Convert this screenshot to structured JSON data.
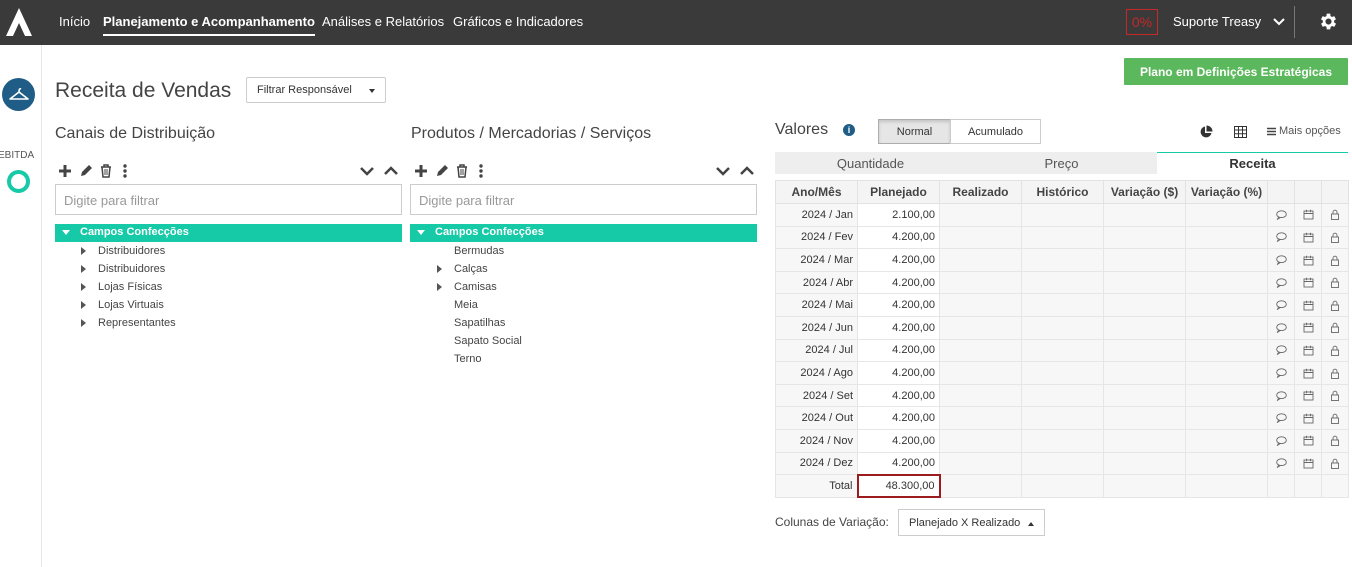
{
  "topbar": {
    "nav": [
      "Início",
      "Planejamento e Acompanhamento",
      "Análises e Relatórios",
      "Gráficos e Indicadores"
    ],
    "percent_badge": "0%",
    "user_name": "Suporte Treasy"
  },
  "sidebar": {
    "label": "EBITDA"
  },
  "page": {
    "title": "Receita de Vendas",
    "filter_responsavel": "Filtrar Responsável",
    "plan_button": "Plano em Definições Estratégicas"
  },
  "canais": {
    "title": "Canais de Distribuição",
    "filter_placeholder": "Digite para filtrar",
    "root": "Campos Confecções",
    "items": [
      {
        "label": "Distribuidores",
        "expandable": true
      },
      {
        "label": "Distribuidores",
        "expandable": true
      },
      {
        "label": "Lojas Físicas",
        "expandable": true
      },
      {
        "label": "Lojas Virtuais",
        "expandable": true
      },
      {
        "label": "Representantes",
        "expandable": true
      }
    ]
  },
  "produtos": {
    "title": "Produtos / Mercadorias / Serviços",
    "filter_placeholder": "Digite para filtrar",
    "root": "Campos Confecções",
    "items": [
      {
        "label": "Bermudas",
        "expandable": false
      },
      {
        "label": "Calças",
        "expandable": true
      },
      {
        "label": "Camisas",
        "expandable": true
      },
      {
        "label": "Meia",
        "expandable": false
      },
      {
        "label": "Sapatilhas",
        "expandable": false
      },
      {
        "label": "Sapato Social",
        "expandable": false
      },
      {
        "label": "Terno",
        "expandable": false
      }
    ]
  },
  "valores": {
    "title": "Valores",
    "toggle_normal": "Normal",
    "toggle_acumulado": "Acumulado",
    "mais_opcoes": "Mais opções",
    "tabs": [
      "Quantidade",
      "Preço",
      "Receita"
    ],
    "active_tab": "Receita",
    "columns": [
      "Ano/Mês",
      "Planejado",
      "Realizado",
      "Histórico",
      "Variação ($)",
      "Variação (%)"
    ],
    "rows": [
      {
        "mes": "2024 / Jan",
        "planejado": "2.100,00"
      },
      {
        "mes": "2024 / Fev",
        "planejado": "4.200,00"
      },
      {
        "mes": "2024 / Mar",
        "planejado": "4.200,00"
      },
      {
        "mes": "2024 / Abr",
        "planejado": "4.200,00"
      },
      {
        "mes": "2024 / Mai",
        "planejado": "4.200,00"
      },
      {
        "mes": "2024 / Jun",
        "planejado": "4.200,00"
      },
      {
        "mes": "2024 / Jul",
        "planejado": "4.200,00"
      },
      {
        "mes": "2024 / Ago",
        "planejado": "4.200,00"
      },
      {
        "mes": "2024 / Set",
        "planejado": "4.200,00"
      },
      {
        "mes": "2024 / Out",
        "planejado": "4.200,00"
      },
      {
        "mes": "2024 / Nov",
        "planejado": "4.200,00"
      },
      {
        "mes": "2024 / Dez",
        "planejado": "4.200,00"
      }
    ],
    "total_label": "Total",
    "total_value": "48.300,00",
    "colunas_variacao_label": "Colunas de Variação:",
    "colunas_variacao_value": "Planejado X Realizado"
  },
  "colors": {
    "accent": "#16c9a7",
    "topbar": "#3a3a3a",
    "primary": "#1f5d86",
    "success": "#5cb85c",
    "danger": "#c62828"
  }
}
